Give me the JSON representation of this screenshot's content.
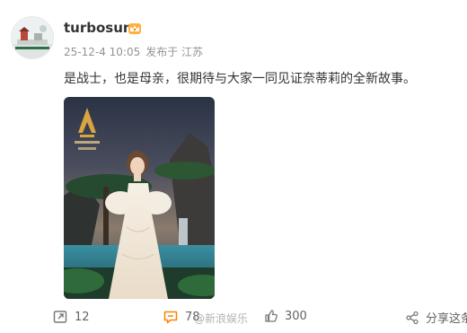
{
  "post": {
    "username": "turbosun",
    "badge_icon": "crown-icon",
    "date": "25-12-4 10:05",
    "location": "发布于 江苏",
    "text": "是战士，也是母亲，很期待与大家一同见证奈蒂莉的全新故事。"
  },
  "actions": {
    "repost_count": "12",
    "comment_count": "78",
    "like_count": "300",
    "share_label": "分享这条"
  },
  "watermark": "@新浪娱乐",
  "colors": {
    "accent_orange": "#ff8200",
    "meta_gray": "#939393",
    "text": "#333333"
  }
}
